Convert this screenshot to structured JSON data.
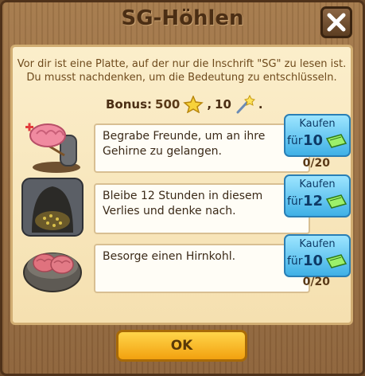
{
  "dialog": {
    "title": "SG-Höhlen",
    "description": "Vor dir ist eine Platte, auf der nur die Inschrift \"SG\" zu lesen ist. Du musst nachdenken, um die Bedeutung zu entschlüsseln.",
    "bonus": {
      "label": "Bonus:",
      "coins": "500",
      "separator": ",",
      "mana": "10",
      "end": "."
    },
    "tasks": [
      {
        "text": "Begrabe Freunde, um an ihre Gehirne zu gelangen.",
        "progress": "0/20",
        "buy_label": "Kaufen",
        "buy_prefix": "für",
        "buy_cost": "10",
        "image": "brain-grave-icon"
      },
      {
        "text": "Bleibe 12 Stunden in diesem Verlies und denke nach.",
        "progress": "",
        "buy_label": "Kaufen",
        "buy_prefix": "für",
        "buy_cost": "12",
        "image": "dungeon-cave-icon"
      },
      {
        "text": "Besorge einen Hirnkohl.",
        "progress": "0/20",
        "buy_label": "Kaufen",
        "buy_prefix": "für",
        "buy_cost": "10",
        "image": "brain-cabbage-bowl-icon"
      }
    ],
    "ok_label": "OK"
  },
  "colors": {
    "parchment": "#f7e6bd",
    "wood": "#9a6f43",
    "buy_button": "#5cc4f0",
    "ok_button": "#f7b82a"
  }
}
